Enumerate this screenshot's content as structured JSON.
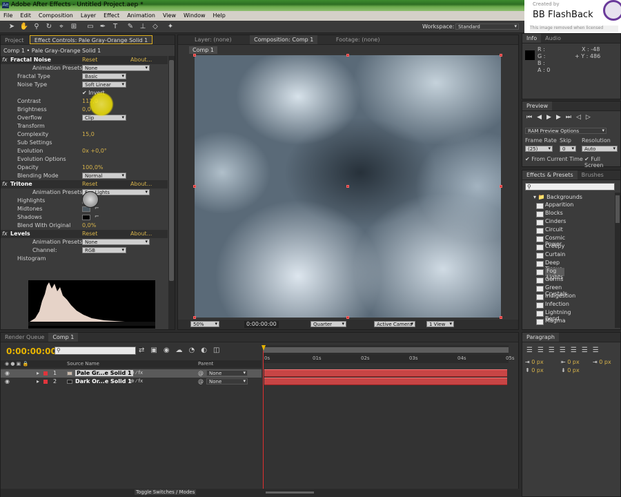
{
  "app": {
    "title": "Adobe After Effects - Untitled Project.aep *"
  },
  "menu": [
    "File",
    "Edit",
    "Composition",
    "Layer",
    "Effect",
    "Animation",
    "View",
    "Window",
    "Help"
  ],
  "workspace": {
    "label": "Workspace:",
    "value": "Standard"
  },
  "watermark": {
    "created": "Created by",
    "brand": "BB FlashBack",
    "notice": "This image removed when licensed"
  },
  "left_panel": {
    "tabs": [
      "Project",
      "Effect Controls: Pale Gray-Orange Solid 1"
    ],
    "subtitle": "Comp 1 • Pale Gray-Orange Solid 1",
    "rows": [
      {
        "label": "Fractal Noise",
        "kind": "effect",
        "reset": "Reset",
        "about": "About..."
      },
      {
        "label": "Animation Presets:",
        "dd": "None"
      },
      {
        "label": "Fractal Type",
        "dd": "Basic"
      },
      {
        "label": "Noise Type",
        "dd": "Soft Linear"
      },
      {
        "label": "",
        "check": "Invert"
      },
      {
        "label": "Contrast",
        "val": "117,0"
      },
      {
        "label": "Brightness",
        "val": "0,0"
      },
      {
        "label": "Overflow",
        "dd": "Clip"
      },
      {
        "label": "Transform"
      },
      {
        "label": "Complexity",
        "val": "15,0"
      },
      {
        "label": "Sub Settings"
      },
      {
        "label": "Evolution",
        "val": "0x +0,0°"
      },
      {
        "label": "Evolution Options"
      },
      {
        "label": "Opacity",
        "val": "100,0%"
      },
      {
        "label": "Blending Mode",
        "dd": "Normal"
      },
      {
        "label": "Tritone",
        "kind": "effect",
        "reset": "Reset",
        "about": "About..."
      },
      {
        "label": "Animation Presets:",
        "dd": "Fog Lights"
      },
      {
        "label": "Highlights",
        "swatch": "#ffffff"
      },
      {
        "label": "Midtones",
        "swatch": "#4e5a62"
      },
      {
        "label": "Shadows",
        "swatch": "#000000"
      },
      {
        "label": "Blend With Original",
        "val": "0,0%"
      },
      {
        "label": "Levels",
        "kind": "effect",
        "reset": "Reset",
        "about": "About..."
      },
      {
        "label": "Animation Presets:",
        "dd": "None"
      },
      {
        "label": "Channel:",
        "dd": "RGB"
      },
      {
        "label": "Histogram"
      }
    ]
  },
  "viewer": {
    "tabs": [
      "Layer: (none)",
      "Composition: Comp 1",
      "Footage: (none)"
    ],
    "comp_tab": "Comp 1",
    "zoom": "50%",
    "timecode": "0:00:00:00",
    "resolution": "Quarter",
    "camera": "Active Camera",
    "views": "1 View"
  },
  "info": {
    "tabs": [
      "Info",
      "Audio"
    ],
    "r": "R :",
    "g": "G :",
    "b": "B :",
    "a": "A : 0",
    "x": "X : -48",
    "y": "+ Y : 486"
  },
  "preview": {
    "title": "Preview",
    "ram": "RAM Preview Options",
    "frame_rate_label": "Frame Rate",
    "frame_rate": "(25)",
    "skip_label": "Skip",
    "skip": "0",
    "resolution_label": "Resolution",
    "resolution": "Auto",
    "from_current": "From Current Time",
    "full_screen": "Full Screen"
  },
  "effects": {
    "tabs": [
      "Effects & Presets",
      "Brushes"
    ],
    "folder": "Backgrounds",
    "items": [
      "Apparition",
      "Blocks",
      "Cinders",
      "Circuit",
      "Cosmic Power",
      "Creepy",
      "Curtain",
      "Deep Tissue",
      "Fog Lights",
      "Germs",
      "Green Crystals",
      "Indigestion",
      "Infection",
      "Lightning Bend",
      "Magma"
    ],
    "selected": "Fog Lights"
  },
  "timeline": {
    "tabs": [
      "Render Queue",
      "Comp 1"
    ],
    "timecode": "0:00:00:00",
    "col_source": "Source Name",
    "col_parent": "Parent",
    "ruler": [
      "0s",
      "01s",
      "02s",
      "03s",
      "04s",
      "05s"
    ],
    "layers": [
      {
        "num": "1",
        "name": "Pale Gr...e Solid 1",
        "color": "#e0353c",
        "parent": "None"
      },
      {
        "num": "2",
        "name": "Dark Or...e Solid 1",
        "color": "#e0353c",
        "parent": "None"
      }
    ],
    "footer": "Toggle Switches / Modes"
  },
  "paragraph": {
    "title": "Paragraph",
    "values": [
      "0 px",
      "0 px",
      "0 px",
      "0 px",
      "0 px"
    ]
  }
}
